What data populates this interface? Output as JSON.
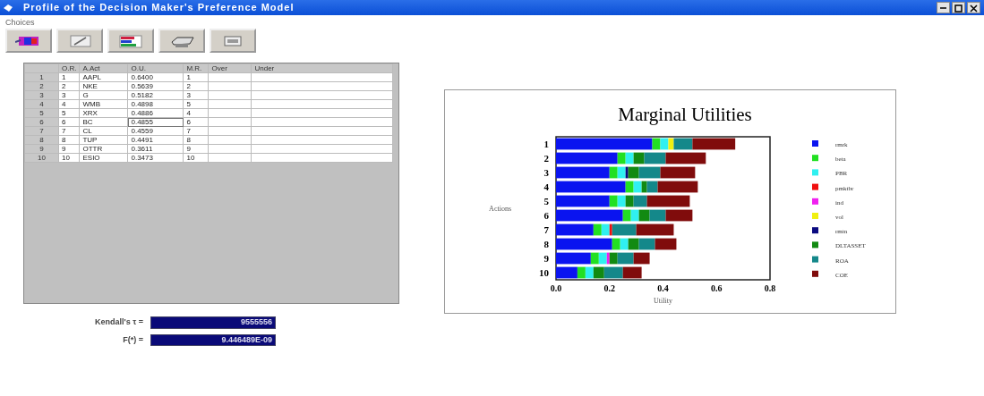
{
  "window": {
    "title": "Profile of the Decision Maker's Preference Model"
  },
  "menu": [
    "Choices"
  ],
  "toolbar": [
    {
      "kind": "palette"
    },
    {
      "kind": "pen"
    },
    {
      "kind": "bars"
    },
    {
      "kind": "printer"
    },
    {
      "kind": "exit"
    }
  ],
  "table": {
    "columns": [
      "",
      "O.R.",
      "A.Act",
      "O.U.",
      "M.R.",
      "Over",
      "Under"
    ],
    "rows": [
      {
        "cells": [
          "1",
          "1",
          "AAPL",
          "0.6400",
          "1",
          "",
          ""
        ],
        "focused": false
      },
      {
        "cells": [
          "2",
          "2",
          "NKE",
          "0.5639",
          "2",
          "",
          ""
        ],
        "focused": false
      },
      {
        "cells": [
          "3",
          "3",
          "G",
          "0.5182",
          "3",
          "",
          ""
        ],
        "focused": false
      },
      {
        "cells": [
          "4",
          "4",
          "WMB",
          "0.4898",
          "5",
          "",
          ""
        ],
        "focused": false
      },
      {
        "cells": [
          "5",
          "5",
          "XRX",
          "0.4886",
          "4",
          "",
          ""
        ],
        "focused": false
      },
      {
        "cells": [
          "6",
          "6",
          "BC",
          "0.4855",
          "6",
          "",
          ""
        ],
        "focused": true
      },
      {
        "cells": [
          "7",
          "7",
          "CL",
          "0.4559",
          "7",
          "",
          ""
        ],
        "focused": false
      },
      {
        "cells": [
          "8",
          "8",
          "TUP",
          "0.4491",
          "8",
          "",
          ""
        ],
        "focused": false
      },
      {
        "cells": [
          "9",
          "9",
          "OTTR",
          "0.3611",
          "9",
          "",
          ""
        ],
        "focused": false
      },
      {
        "cells": [
          "10",
          "10",
          "ESIO",
          "0.3473",
          "10",
          "",
          ""
        ],
        "focused": false
      }
    ]
  },
  "results": [
    {
      "label": "Kendall's τ =",
      "value": "9555556"
    },
    {
      "label": "F(*) =",
      "value": "9.446489E-09"
    }
  ],
  "chart": {
    "chart_data": {
      "type": "bar",
      "orientation": "horizontal",
      "stacked": true,
      "title": "Marginal Utilities",
      "xlabel": "Utility",
      "ylabel": "Actions",
      "categories": [
        "1",
        "2",
        "3",
        "4",
        "5",
        "6",
        "7",
        "8",
        "9",
        "10"
      ],
      "legend": "right",
      "xlim": [
        0,
        0.8
      ],
      "xticks": [
        {
          "value": 0,
          "label": "0.0"
        },
        {
          "value": 0.2,
          "label": "0.2"
        },
        {
          "value": 0.4,
          "label": "0.4"
        },
        {
          "value": 0.6,
          "label": "0.6"
        },
        {
          "value": 0.8,
          "label": "0.8"
        }
      ],
      "series": [
        {
          "name": "rmrk",
          "color": "#0a14f0",
          "values": [
            0.36,
            0.23,
            0.2,
            0.26,
            0.2,
            0.25,
            0.14,
            0.21,
            0.13,
            0.08
          ]
        },
        {
          "name": "beta",
          "color": "#22e022",
          "values": [
            0.03,
            0.03,
            0.03,
            0.03,
            0.03,
            0.03,
            0.03,
            0.03,
            0.03,
            0.03
          ]
        },
        {
          "name": "PBR",
          "color": "#30f0f0",
          "values": [
            0.03,
            0.03,
            0.03,
            0.03,
            0.03,
            0.03,
            0.03,
            0.03,
            0.03,
            0.03
          ]
        },
        {
          "name": "pmktbr",
          "color": "#f01010",
          "values": [
            0,
            0,
            0,
            0,
            0,
            0,
            0.01,
            0,
            0,
            0
          ]
        },
        {
          "name": "ind",
          "color": "#f020f0",
          "values": [
            0,
            0,
            0,
            0,
            0,
            0,
            0,
            0,
            0.01,
            0
          ]
        },
        {
          "name": "vol",
          "color": "#f0f010",
          "values": [
            0.02,
            0,
            0,
            0,
            0,
            0,
            0,
            0,
            0,
            0
          ]
        },
        {
          "name": "rmtn",
          "color": "#0a0a80",
          "values": [
            0,
            0,
            0.01,
            0,
            0,
            0,
            0,
            0,
            0,
            0
          ]
        },
        {
          "name": "DLTASSET",
          "color": "#128a12",
          "values": [
            0,
            0.04,
            0.04,
            0.02,
            0.03,
            0.04,
            0,
            0.04,
            0.03,
            0.04
          ]
        },
        {
          "name": "ROA",
          "color": "#14888a",
          "values": [
            0.07,
            0.08,
            0.08,
            0.04,
            0.05,
            0.06,
            0.09,
            0.06,
            0.06,
            0.07
          ]
        },
        {
          "name": "COE",
          "color": "#800c0c",
          "values": [
            0.16,
            0.15,
            0.13,
            0.15,
            0.16,
            0.1,
            0.14,
            0.08,
            0.06,
            0.07
          ]
        }
      ]
    }
  }
}
